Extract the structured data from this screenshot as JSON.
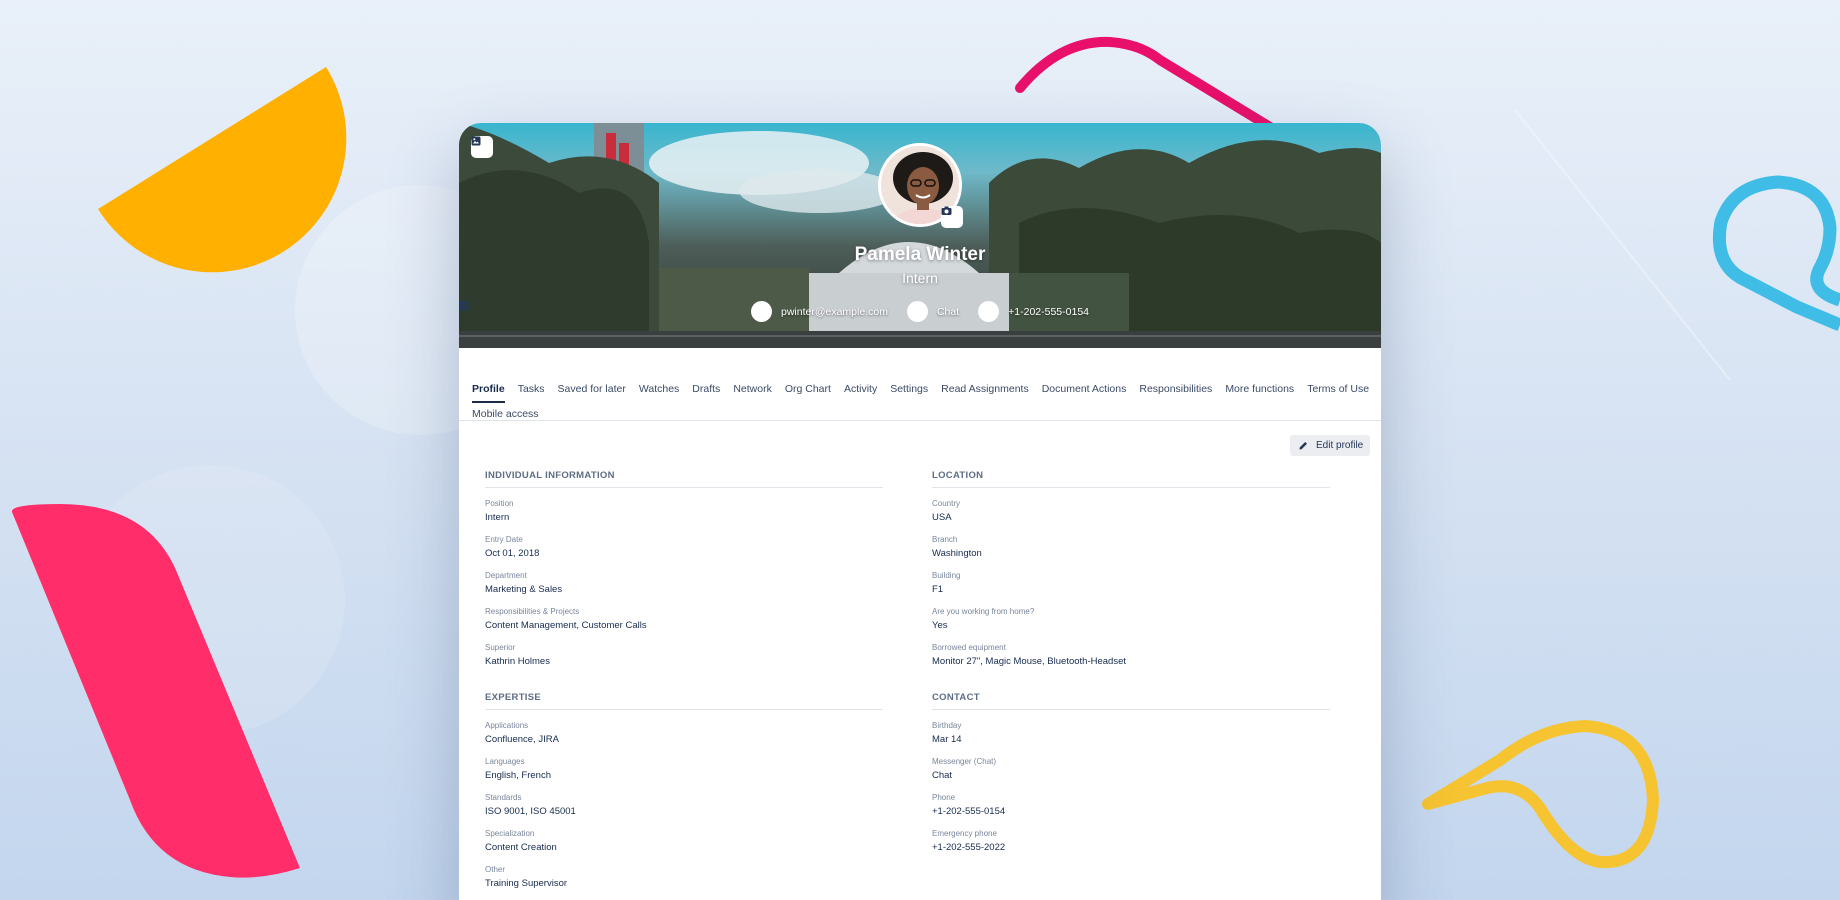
{
  "profile": {
    "name": "Pamela Winter",
    "role": "Intern",
    "email": "pwinter@example.com",
    "chat": "Chat",
    "phone": "+1-202-555-0154"
  },
  "tabs": [
    {
      "label": "Profile",
      "active": true
    },
    {
      "label": "Tasks"
    },
    {
      "label": "Saved for later"
    },
    {
      "label": "Watches"
    },
    {
      "label": "Drafts"
    },
    {
      "label": "Network"
    },
    {
      "label": "Org Chart"
    },
    {
      "label": "Activity"
    },
    {
      "label": "Settings"
    },
    {
      "label": "Read Assignments"
    },
    {
      "label": "Document Actions"
    },
    {
      "label": "Responsibilities"
    },
    {
      "label": "More functions"
    },
    {
      "label": "Terms of Use"
    },
    {
      "label": "Mobile access"
    }
  ],
  "edit_button": {
    "label": "Edit profile"
  },
  "sections": {
    "individual": {
      "title": "INDIVIDUAL INFORMATION",
      "fields": [
        {
          "label": "Position",
          "value": "Intern"
        },
        {
          "label": "Entry Date",
          "value": "Oct 01, 2018"
        },
        {
          "label": "Department",
          "value": "Marketing & Sales"
        },
        {
          "label": "Responsibilities & Projects",
          "value": "Content Management, Customer Calls"
        },
        {
          "label": "Superior",
          "value": "Kathrin Holmes"
        }
      ]
    },
    "location": {
      "title": "LOCATION",
      "fields": [
        {
          "label": "Country",
          "value": "USA"
        },
        {
          "label": "Branch",
          "value": "Washington"
        },
        {
          "label": "Building",
          "value": "F1"
        },
        {
          "label": "Are you working from home?",
          "value": "Yes"
        },
        {
          "label": "Borrowed equipment",
          "value": "Monitor 27\", Magic Mouse, Bluetooth-Headset"
        }
      ]
    },
    "expertise": {
      "title": "EXPERTISE",
      "fields": [
        {
          "label": "Applications",
          "value": "Confluence, JIRA"
        },
        {
          "label": "Languages",
          "value": "English, French"
        },
        {
          "label": "Standards",
          "value": "ISO 9001, ISO 45001"
        },
        {
          "label": "Specialization",
          "value": "Content Creation"
        },
        {
          "label": "Other",
          "value": "Training Supervisor"
        }
      ]
    },
    "contact": {
      "title": "CONTACT",
      "fields": [
        {
          "label": "Birthday",
          "value": "Mar 14"
        },
        {
          "label": "Messenger (Chat)",
          "value": "Chat"
        },
        {
          "label": "Phone",
          "value": "+1-202-555-0154"
        },
        {
          "label": "Emergency phone",
          "value": "+1-202-555-2022"
        }
      ]
    }
  },
  "icons": {
    "cover_button": "image-icon",
    "camera": "camera-icon",
    "email": "mail-icon",
    "chat": "chat-bubble-icon",
    "phone": "phone-icon",
    "edit": "pencil-icon"
  },
  "colors": {
    "text_primary": "#172b4d",
    "text_muted": "#7a869a",
    "accent_orange": "#ffb000",
    "accent_pink": "#ff2e6b",
    "accent_magenta": "#e8106b",
    "accent_blue": "#3fbde6",
    "accent_yellow": "#f6c431"
  }
}
